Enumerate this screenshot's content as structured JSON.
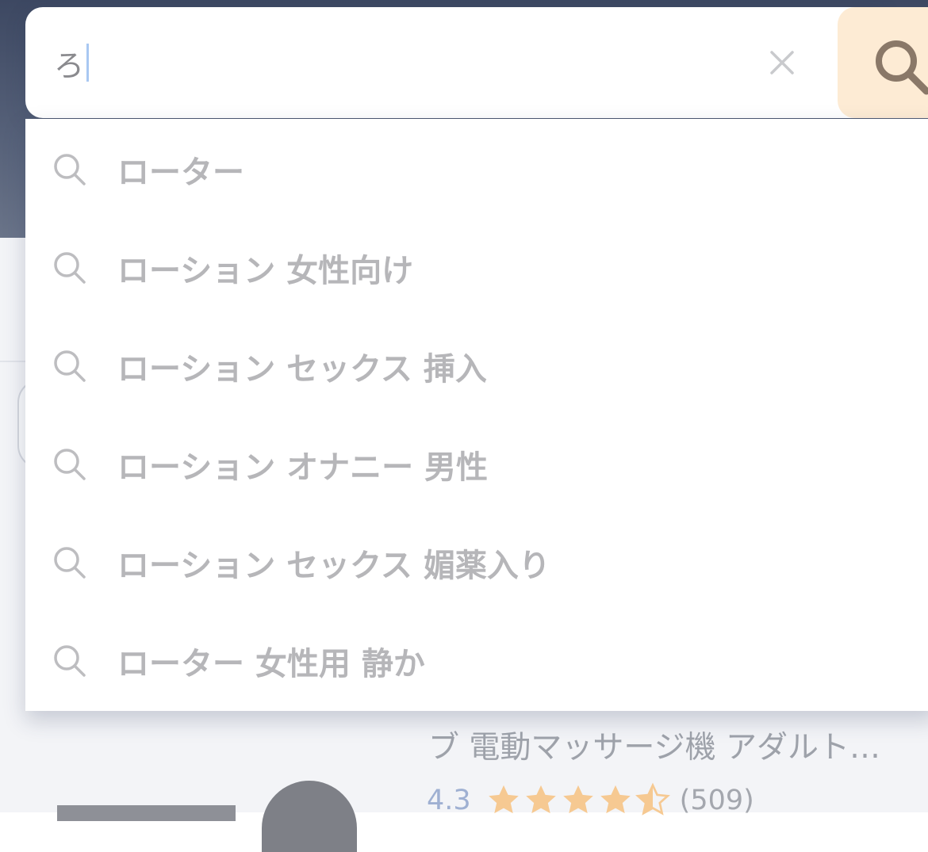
{
  "search": {
    "query": "ろ",
    "clear_icon": "close-icon",
    "submit_icon": "search-icon",
    "accent_color": "#fdebd4"
  },
  "suggestions": [
    {
      "label": "ローター",
      "icon": "search-icon"
    },
    {
      "label": "ローション 女性向け",
      "icon": "search-icon"
    },
    {
      "label": "ローション セックス 挿入",
      "icon": "search-icon"
    },
    {
      "label": "ローション オナニー 男性",
      "icon": "search-icon"
    },
    {
      "label": "ローション セックス 媚薬入り",
      "icon": "search-icon"
    },
    {
      "label": "ローター 女性用 静か",
      "icon": "search-icon"
    }
  ],
  "background_product": {
    "title": "ブ 電動マッサージ機 アダルト…",
    "rating": "4.3",
    "review_count": "(509)",
    "star_color": "#f6c992"
  }
}
